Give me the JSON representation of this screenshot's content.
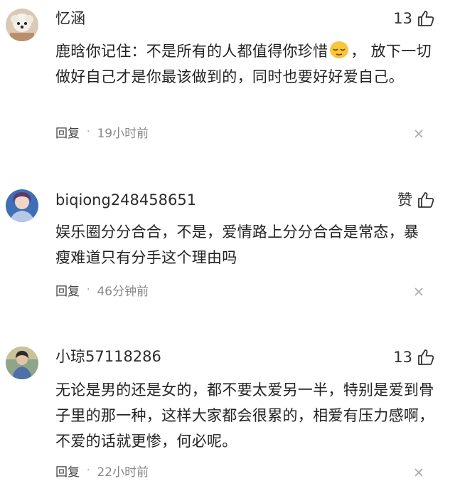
{
  "comments": [
    {
      "username": "忆涵",
      "likes": "13",
      "content_before_emoji": "鹿晗你记住：不是所有的人都值得你珍惜",
      "emoji_icon": "relieved-face-emoji-icon",
      "content_after_emoji": "， 放下一切做好自己才是你最该做到的，同时也要好好爱自己。",
      "reply_label": "回复",
      "separator": "·",
      "time": "19小时前"
    },
    {
      "username": "biqiong248458651",
      "likes": "赞",
      "content": "娱乐圈分分合合，不是，爱情路上分分合合是常态，暴瘦难道只有分手这个理由吗",
      "reply_label": "回复",
      "separator": "·",
      "time": "46分钟前"
    },
    {
      "username": "小琼57118286",
      "likes": "13",
      "content": "无论是男的还是女的，都不要太爱另一半，特别是爱到骨子里的那一种，这样大家都会很累的，相爱有压力感啊，不爱的话就更惨，何必呢。",
      "reply_label": "回复",
      "separator": "·",
      "time": "22小时前"
    }
  ],
  "icons": {
    "like": "thumbs-up-icon",
    "dismiss": "close-icon"
  },
  "colors": {
    "text": "#222222",
    "meta": "#888888",
    "icon": "#333333"
  }
}
